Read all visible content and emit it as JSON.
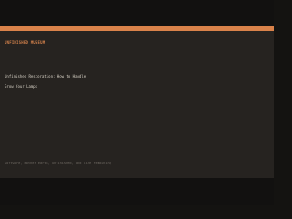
{
  "header": {
    "brand": "UNFINISHED MUSEUM",
    "accent_color": "#d9824a"
  },
  "menu": {
    "items": [
      {
        "label": "Unfinished Restoration: How to Handle"
      },
      {
        "label": "Grow Your Lamps"
      }
    ]
  },
  "footer": {
    "tagline": "Software, mother earth, unfinished, and life remaining"
  }
}
